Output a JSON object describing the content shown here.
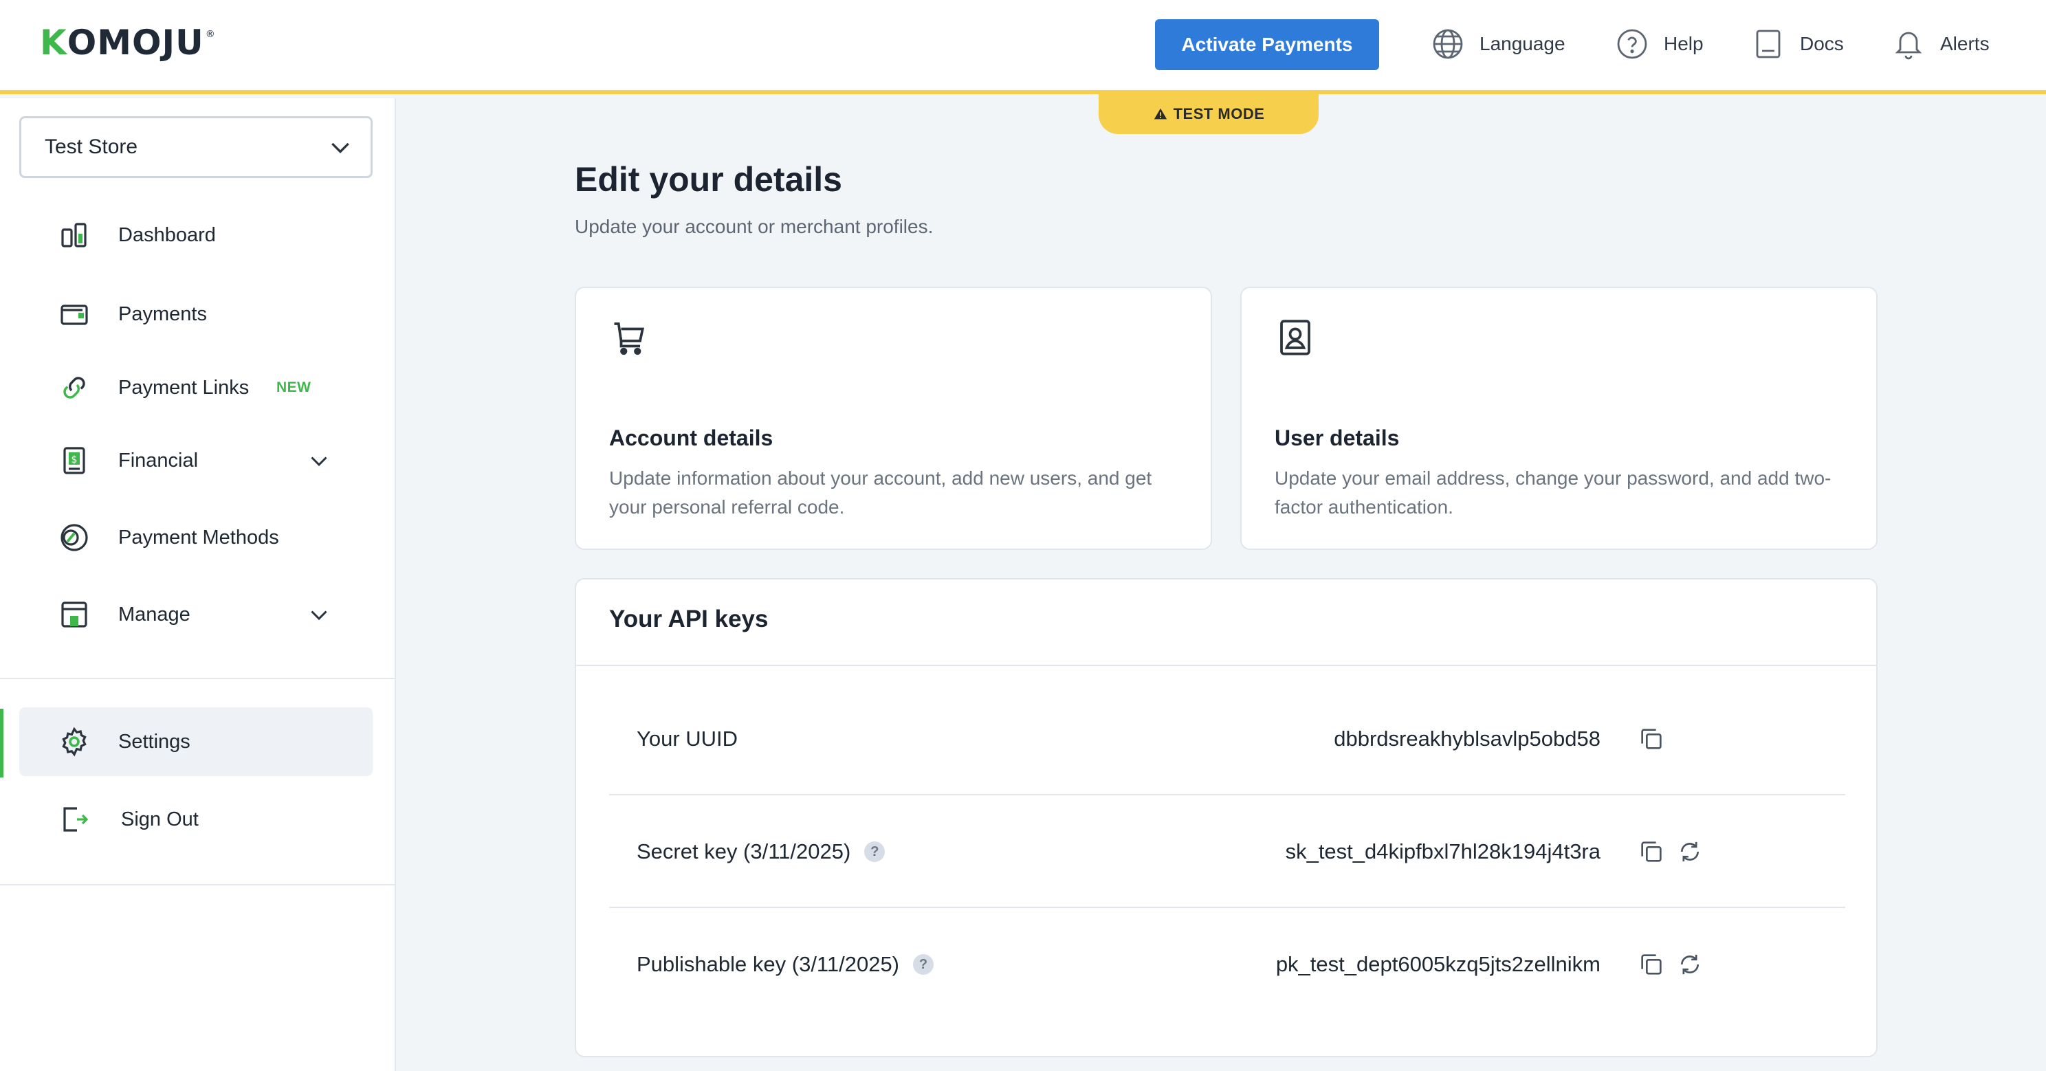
{
  "header": {
    "logo": "KOMOJU",
    "activate_label": "Activate Payments",
    "language_label": "Language",
    "help_label": "Help",
    "docs_label": "Docs",
    "alerts_label": "Alerts",
    "test_mode_label": "TEST MODE"
  },
  "sidebar": {
    "store_name": "Test Store",
    "items": [
      {
        "label": "Dashboard",
        "icon": "dashboard-icon"
      },
      {
        "label": "Payments",
        "icon": "wallet-icon"
      },
      {
        "label": "Payment Links",
        "icon": "link-icon",
        "badge": "NEW"
      },
      {
        "label": "Financial",
        "icon": "financial-icon"
      },
      {
        "label": "Payment Methods",
        "icon": "payment-methods-icon"
      },
      {
        "label": "Manage",
        "icon": "store-icon"
      },
      {
        "label": "Settings",
        "icon": "gear-icon"
      },
      {
        "label": "Sign Out",
        "icon": "sign-out-icon"
      }
    ]
  },
  "main": {
    "title": "Edit your details",
    "subtitle": "Update your account or merchant profiles.",
    "cards": [
      {
        "title": "Account details",
        "description": "Update information about your account, add new users, and get your personal referral code."
      },
      {
        "title": "User details",
        "description": "Update your email address, change your password, and add two-factor authentication."
      }
    ],
    "api": {
      "title": "Your API keys",
      "rows": [
        {
          "label": "Your UUID",
          "value": "dbbrdsreakhyblsavlp5obd58"
        },
        {
          "label": "Secret key (3/11/2025)",
          "value": "sk_test_d4kipfbxl7hl28k194j4t3ra"
        },
        {
          "label": "Publishable key (3/11/2025)",
          "value": "pk_test_dept6005kzq5jts2zellnikm"
        }
      ]
    }
  },
  "colors": {
    "accent_blue": "#2f7bd9",
    "brand_green": "#3eb84a",
    "test_yellow": "#f6d04d"
  }
}
